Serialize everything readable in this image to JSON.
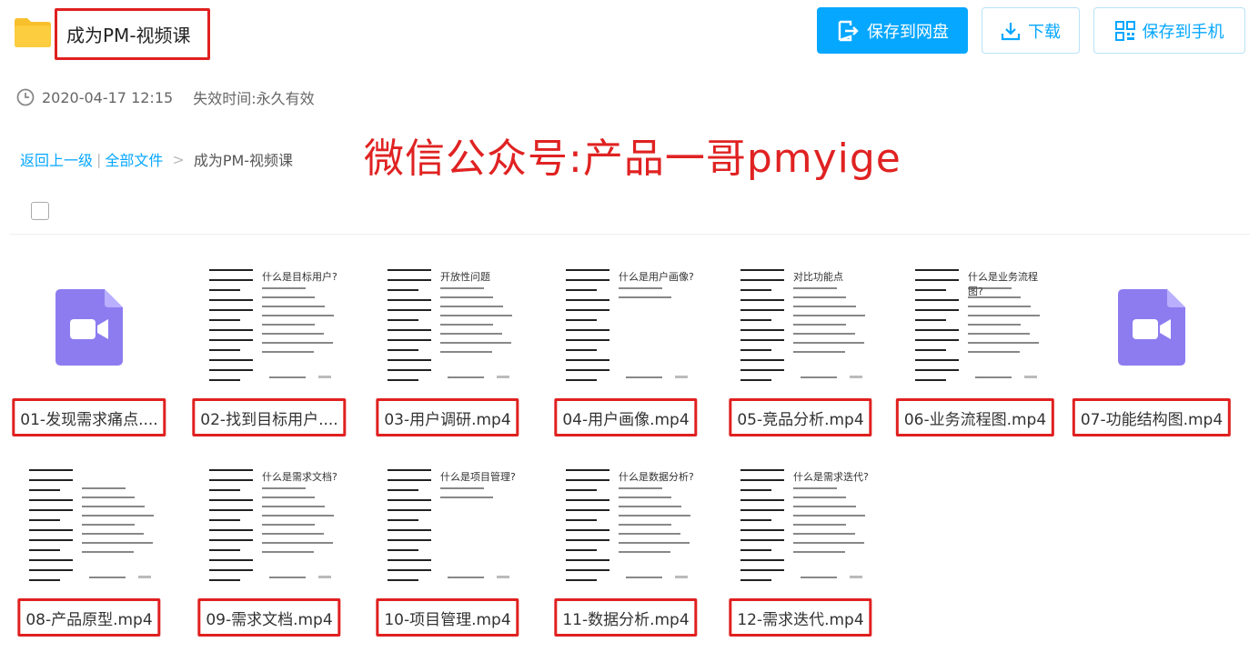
{
  "header": {
    "folder_title": "成为PM-视频课",
    "buttons": {
      "save_to_netdisk": "保存到网盘",
      "download": "下载",
      "save_to_phone": "保存到手机"
    }
  },
  "meta": {
    "date": "2020-04-17 12:15",
    "expiry_label": "失效时间:",
    "expiry_value": "永久有效"
  },
  "breadcrumb": {
    "back": "返回上一级",
    "separator": "|",
    "all_files": "全部文件",
    "arrow": ">",
    "current": "成为PM-视频课"
  },
  "watermark": "微信公众号:产品一哥pmyige",
  "files": [
    {
      "name": "01-发现需求痛点....",
      "thumb": "video"
    },
    {
      "name": "02-找到目标用户....",
      "thumb": "doc",
      "title": "什么是目标用户?"
    },
    {
      "name": "03-用户调研.mp4",
      "thumb": "doc",
      "title": "开放性问题"
    },
    {
      "name": "04-用户画像.mp4",
      "thumb": "doc",
      "title": "什么是用户画像?"
    },
    {
      "name": "05-竞品分析.mp4",
      "thumb": "doc",
      "title": "对比功能点"
    },
    {
      "name": "06-业务流程图.mp4",
      "thumb": "doc",
      "title": "什么是业务流程图?"
    },
    {
      "name": "07-功能结构图.mp4",
      "thumb": "video"
    },
    {
      "name": "08-产品原型.mp4",
      "thumb": "doc",
      "title": ""
    },
    {
      "name": "09-需求文档.mp4",
      "thumb": "doc",
      "title": "什么是需求文档?"
    },
    {
      "name": "10-项目管理.mp4",
      "thumb": "doc",
      "title": "什么是项目管理?"
    },
    {
      "name": "11-数据分析.mp4",
      "thumb": "doc",
      "title": "什么是数据分析?"
    },
    {
      "name": "12-需求迭代.mp4",
      "thumb": "doc",
      "title": "什么是需求迭代?"
    }
  ],
  "colors": {
    "accent": "#06a7ff",
    "highlight": "#e02020",
    "video_icon": "#8c7cf0",
    "folder": "#f8c02c"
  }
}
